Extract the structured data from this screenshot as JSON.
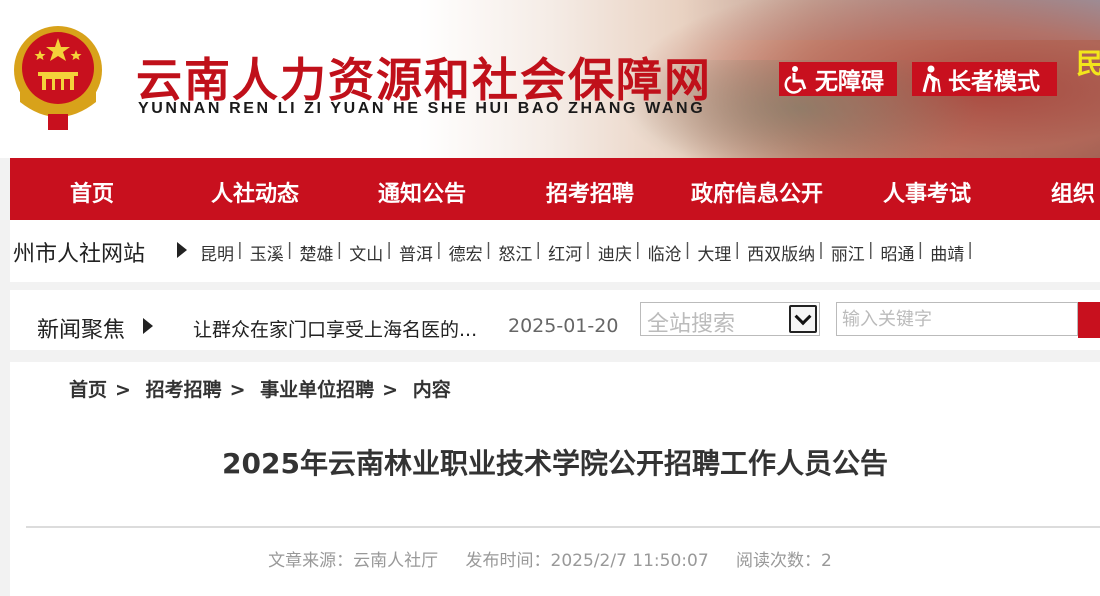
{
  "header": {
    "site_title": "云南人力资源和社会保障网",
    "site_pinyin": "YUNNAN REN LI ZI YUAN HE SHE HUI BAO ZHANG WANG",
    "accessibility_label": "无障碍",
    "elder_mode_label": "长者模式",
    "corner_char": "民",
    "brand_color": "#c8101e"
  },
  "nav": {
    "items": [
      "首页",
      "人社动态",
      "通知公告",
      "招考招聘",
      "政府信息公开",
      "人事考试",
      "组织"
    ]
  },
  "citybar": {
    "label": "州市人社网站",
    "cities": [
      "昆明",
      "玉溪",
      "楚雄",
      "文山",
      "普洱",
      "德宏",
      "怒江",
      "红河",
      "迪庆",
      "临沧",
      "大理",
      "西双版纳",
      "丽江",
      "昭通",
      "曲靖"
    ]
  },
  "news": {
    "label": "新闻聚焦",
    "headline": "让群众在家门口享受上海名医的...",
    "date": "2025-01-20"
  },
  "search": {
    "scope": "全站搜索",
    "placeholder": "输入关键字"
  },
  "breadcrumb": [
    "首页",
    "招考招聘",
    "事业单位招聘",
    "内容"
  ],
  "article": {
    "title": "2025年云南林业职业技术学院公开招聘工作人员公告",
    "source": "文章来源：云南人社厅",
    "published": "发布时间：2025/2/7 11:50:07",
    "reads": "阅读次数：2"
  }
}
